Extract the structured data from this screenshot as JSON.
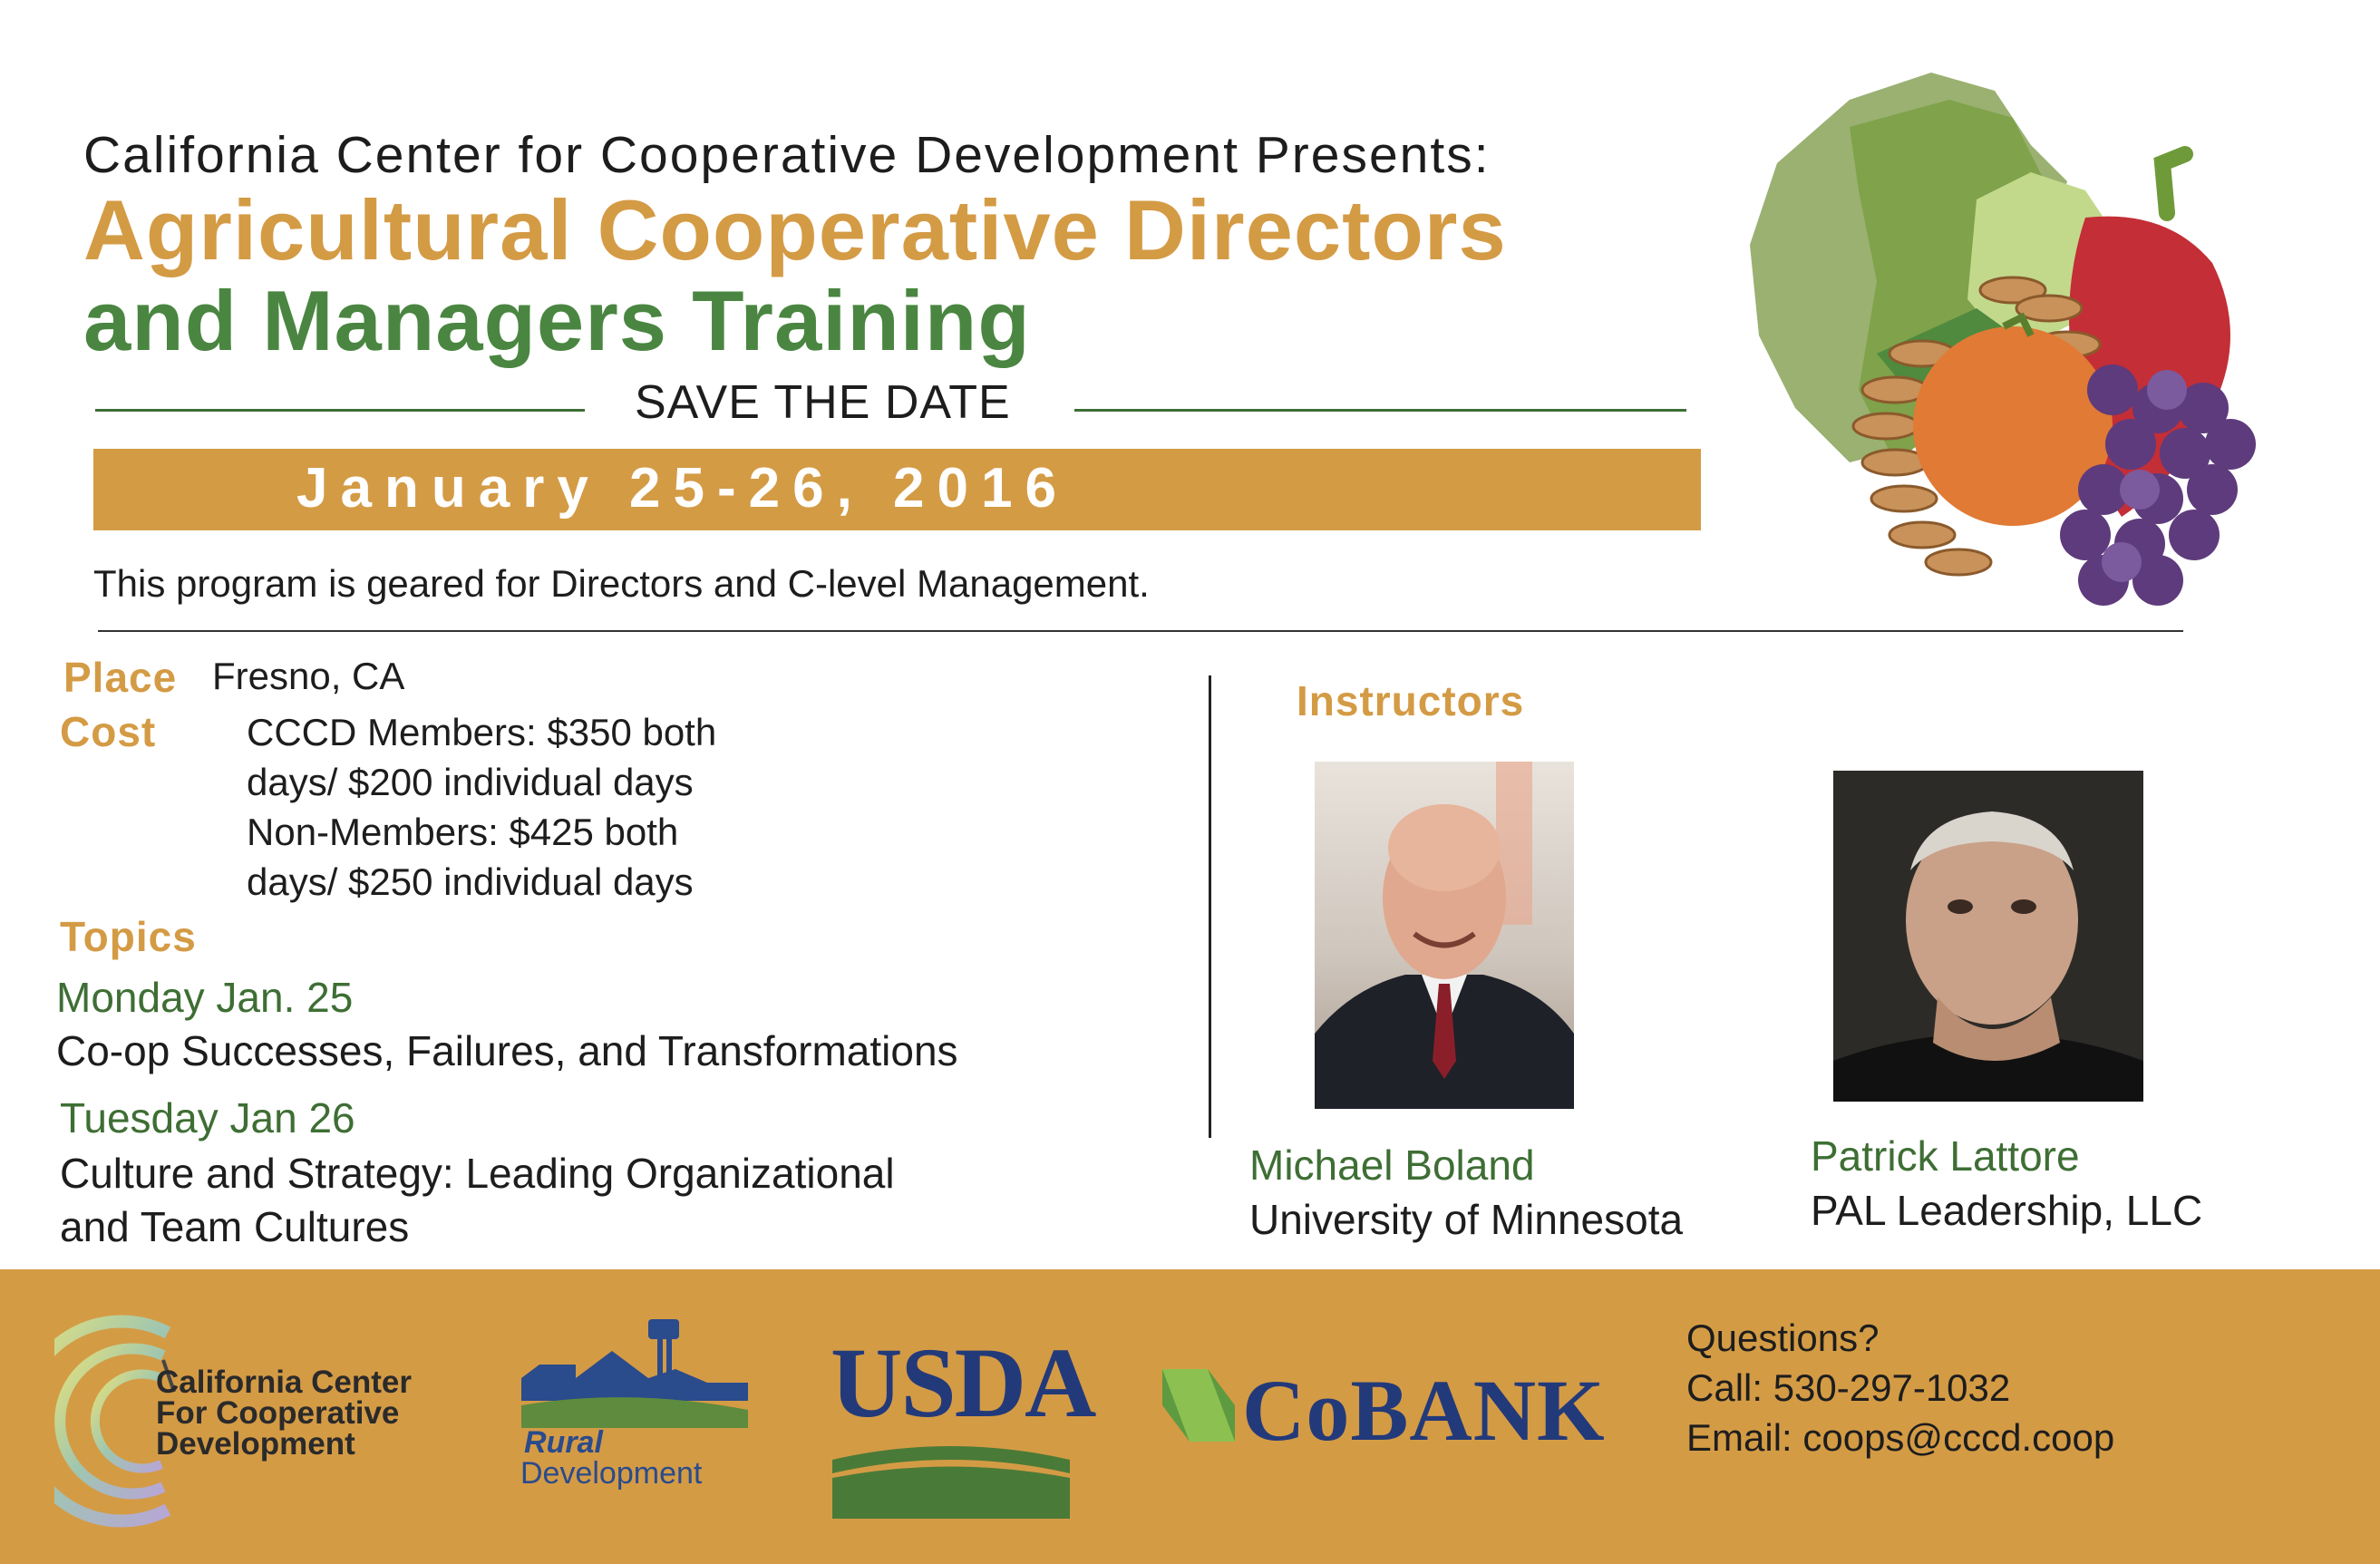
{
  "header": {
    "presenter": "California Center for Cooperative Development Presents:",
    "title_line1": "Agricultural Cooperative Directors",
    "title_line2": "and Managers Training",
    "save_the_date": "SAVE THE DATE",
    "date": "January 25-26, 2016",
    "geared": "This program is geared for Directors and C-level Management."
  },
  "details": {
    "place_label": "Place",
    "place_value": "Fresno, CA",
    "cost_label": "Cost",
    "cost_lines": [
      "CCCD Members: $350 both",
      "days/ $200 individual days",
      "Non-Members: $425 both",
      "days/ $250 individual days"
    ],
    "topics_label": "Topics",
    "monday_label": "Monday Jan. 25",
    "monday_topic": "Co-op Successes, Failures, and Transformations",
    "tuesday_label": "Tuesday Jan 26",
    "tuesday_topic_line1": "Culture and Strategy: Leading Organizational",
    "tuesday_topic_line2": "and Team Cultures"
  },
  "instructors": {
    "label": "Instructors",
    "people": [
      {
        "name": "Michael Boland",
        "org": "University of Minnesota"
      },
      {
        "name": "Patrick Lattore",
        "org": "PAL Leadership, LLC"
      }
    ]
  },
  "footer": {
    "cccd_lines": [
      "California Center",
      "For Cooperative",
      "Development"
    ],
    "rd_line1": "Rural",
    "rd_line2": "Development",
    "usda": "USDA",
    "cobank": "CoBANK",
    "contact_lines": [
      "Questions?",
      "Call: 530-297-1032",
      "Email: coops@cccd.coop"
    ]
  },
  "colors": {
    "gold": "#d49b45",
    "green": "#4a8641",
    "navy": "#233a7a"
  },
  "icons": [
    "produce-illustration",
    "cccd-logo-icon",
    "rural-development-logo-icon",
    "usda-logo-icon",
    "cobank-logo-icon"
  ]
}
